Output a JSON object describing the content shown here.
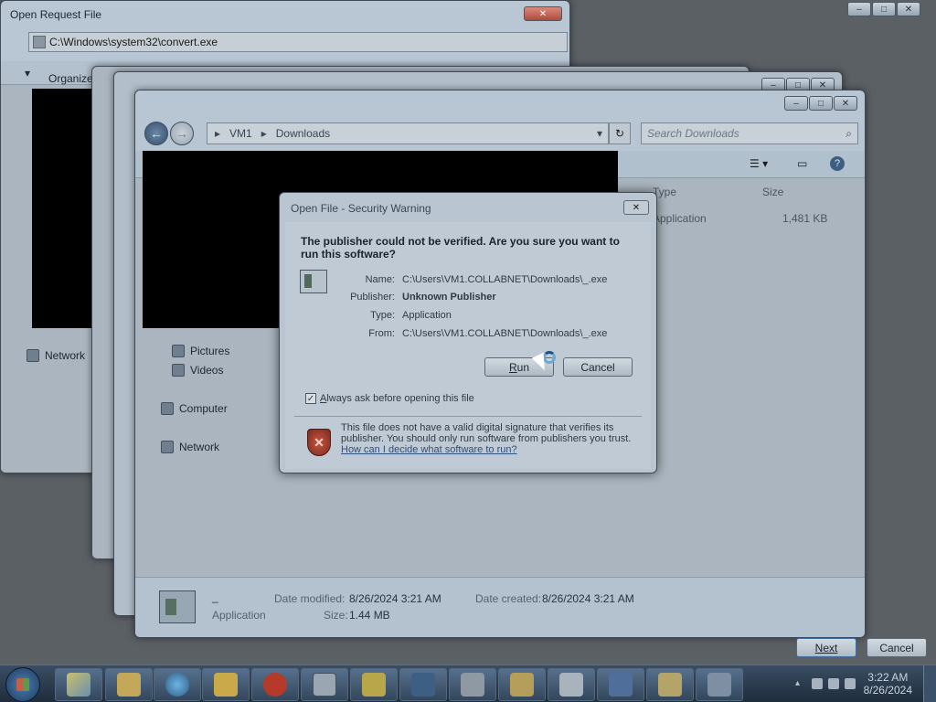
{
  "windows": {
    "open_request": {
      "title": "Open Request File",
      "address": "C:\\Windows\\system32\\convert.exe",
      "organize": "Organize",
      "network": "Network"
    },
    "downloads": {
      "breadcrumb": [
        "VM1",
        "Downloads"
      ],
      "search_placeholder": "Search Downloads",
      "columns": {
        "type": "Type",
        "size": "Size"
      },
      "row": {
        "type": "Application",
        "size": "1,481 KB"
      },
      "nav": {
        "pictures": "Pictures",
        "videos": "Videos",
        "computer": "Computer",
        "network": "Network"
      },
      "details": {
        "name": "_",
        "kind": "Application",
        "date_modified_label": "Date modified:",
        "date_modified": "8/26/2024 3:21 AM",
        "date_created_label": "Date created:",
        "date_created": "8/26/2024 3:21 AM",
        "size_label": "Size:",
        "size": "1.44 MB"
      }
    }
  },
  "dialog": {
    "title": "Open File - Security Warning",
    "question": "The publisher could not be verified.  Are you sure you want to run this software?",
    "fields": {
      "name_label": "Name:",
      "name": "C:\\Users\\VM1.COLLABNET\\Downloads\\_.exe",
      "publisher_label": "Publisher:",
      "publisher": "Unknown Publisher",
      "type_label": "Type:",
      "type": "Application",
      "from_label": "From:",
      "from": "C:\\Users\\VM1.COLLABNET\\Downloads\\_.exe"
    },
    "run_prefix": "R",
    "run_suffix": "un",
    "cancel": "Cancel",
    "checkbox_prefix": "A",
    "checkbox_suffix": "lways ask before opening this file",
    "checkbox_checked": true,
    "warning": "This file does not have a valid digital signature that verifies its publisher.  You should only run software from publishers you trust.",
    "help_link": "How can I decide what software to run?"
  },
  "wizard": {
    "next": "Next",
    "cancel": "Cancel"
  },
  "taskbar": {
    "time": "3:22 AM",
    "date": "8/26/2024"
  }
}
